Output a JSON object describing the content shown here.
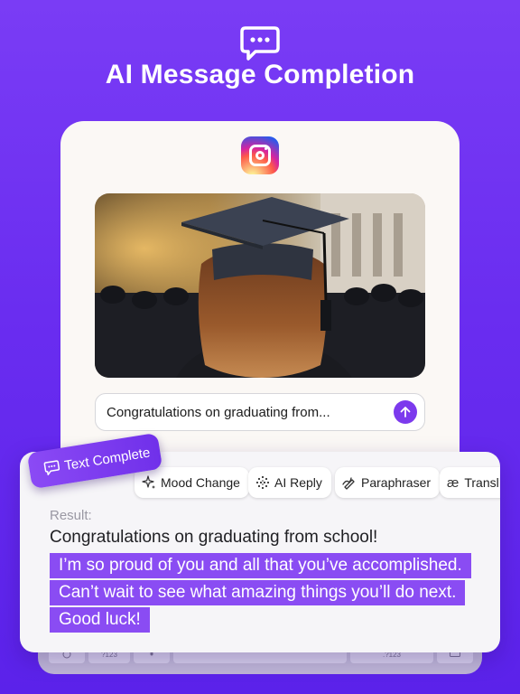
{
  "hero": {
    "icon": "chat-bubble-dots-icon",
    "title": "AI Message Completion"
  },
  "app": {
    "logo": "instagram-logo-icon",
    "message_input_value": "Congratulations on graduating from...",
    "send_icon": "arrow-up-icon"
  },
  "badge": {
    "icon": "chat-bubble-dots-icon",
    "label": "Text Complete"
  },
  "toolbar": {
    "chips": [
      {
        "icon": "sparkle-icon",
        "label": "Mood Change"
      },
      {
        "icon": "dot-grid-icon",
        "label": "AI Reply"
      },
      {
        "icon": "pen-scribble-icon",
        "label": "Paraphraser"
      },
      {
        "icon": "ae-glyph-icon",
        "label": "Transl"
      }
    ]
  },
  "result": {
    "label": "Result:",
    "line1": "Congratulations on graduating from school!",
    "highlighted": [
      "I’m so proud of you and all that you’ve accomplished.",
      "Can’t wait to see what amazing things you’ll do next.",
      "Good luck!"
    ]
  },
  "keyboard": {
    "keys": [
      "?123",
      ".?123"
    ]
  },
  "colors": {
    "background_top": "#7a3cf5",
    "background_bottom": "#5b22ea",
    "accent": "#7c3aed",
    "highlight": "#8a4cf3"
  }
}
